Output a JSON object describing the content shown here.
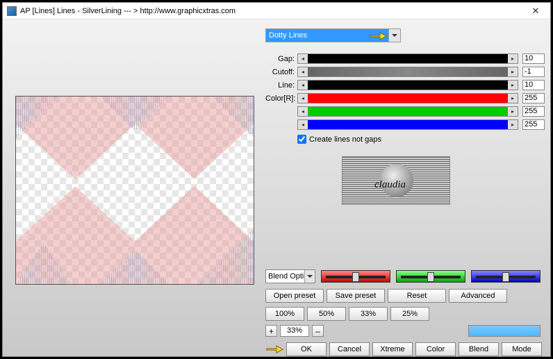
{
  "titlebar": {
    "title": "AP [Lines]  Lines - SilverLining    --- >  http://www.graphicxtras.com"
  },
  "preset_dropdown": {
    "selected": "Dotty Lines"
  },
  "sliders": {
    "gap": {
      "label": "Gap:",
      "value": "10"
    },
    "cutoff": {
      "label": "Cutoff:",
      "value": "-1"
    },
    "line": {
      "label": "Line:",
      "value": "10"
    },
    "colorR": {
      "label": "Color[R]:",
      "value": "255"
    },
    "colorG": {
      "label": "",
      "value": "255"
    },
    "colorB": {
      "label": "",
      "value": "255"
    }
  },
  "checkbox": {
    "create_lines_not_gaps": "Create lines not gaps"
  },
  "logo": {
    "text": "claudia"
  },
  "blend_combo": {
    "label": "Blend Optic"
  },
  "buttons": {
    "open_preset": "Open preset",
    "save_preset": "Save preset",
    "reset": "Reset",
    "advanced": "Advanced",
    "pct100": "100%",
    "pct50": "50%",
    "pct33": "33%",
    "pct25": "25%",
    "ok": "OK",
    "cancel": "Cancel",
    "xtreme": "Xtreme",
    "color": "Color",
    "blend": "Blend",
    "mode": "Mode"
  },
  "stepper": {
    "minus1": "+",
    "value": "33%",
    "minus2": "–"
  }
}
